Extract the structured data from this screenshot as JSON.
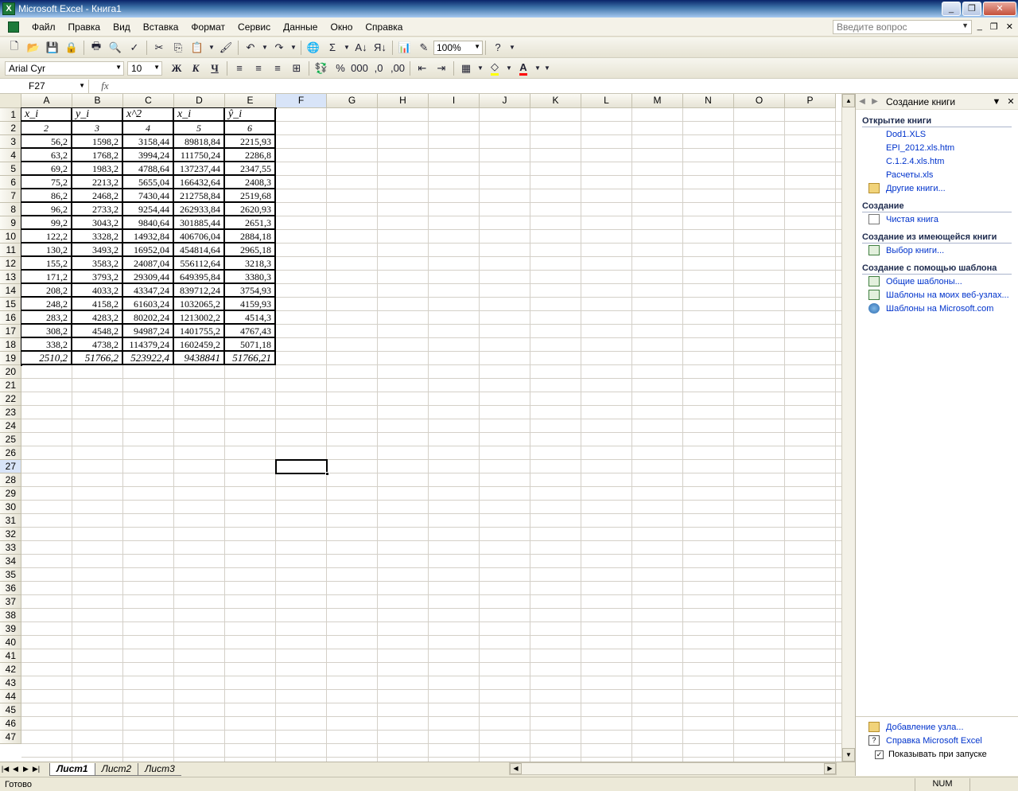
{
  "window": {
    "title": "Microsoft Excel - Книга1"
  },
  "menu": {
    "items": [
      "Файл",
      "Правка",
      "Вид",
      "Вставка",
      "Формат",
      "Сервис",
      "Данные",
      "Окно",
      "Справка"
    ],
    "help_placeholder": "Введите вопрос"
  },
  "toolbar": {
    "zoom": "100%",
    "font_name": "Arial Cyr",
    "font_size": "10",
    "bold_label": "Ж",
    "italic_label": "К",
    "underline_label": "Ч"
  },
  "formula_bar": {
    "name_box": "F27",
    "fx_label": "fx",
    "content": ""
  },
  "grid": {
    "columns": [
      "A",
      "B",
      "C",
      "D",
      "E",
      "F",
      "G",
      "H",
      "I",
      "J",
      "K",
      "L",
      "M",
      "N",
      "O",
      "P"
    ],
    "active_column": "F",
    "active_row": 27,
    "row_count": 47,
    "table_header": [
      "x_i",
      "y_i",
      "x^2",
      "x_i",
      "ŷ_i"
    ],
    "table_index": [
      "2",
      "3",
      "4",
      "5",
      "6"
    ],
    "table_rows": [
      [
        "56,2",
        "1598,2",
        "3158,44",
        "89818,84",
        "2215,93"
      ],
      [
        "63,2",
        "1768,2",
        "3994,24",
        "111750,24",
        "2286,8"
      ],
      [
        "69,2",
        "1983,2",
        "4788,64",
        "137237,44",
        "2347,55"
      ],
      [
        "75,2",
        "2213,2",
        "5655,04",
        "166432,64",
        "2408,3"
      ],
      [
        "86,2",
        "2468,2",
        "7430,44",
        "212758,84",
        "2519,68"
      ],
      [
        "96,2",
        "2733,2",
        "9254,44",
        "262933,84",
        "2620,93"
      ],
      [
        "99,2",
        "3043,2",
        "9840,64",
        "301885,44",
        "2651,3"
      ],
      [
        "122,2",
        "3328,2",
        "14932,84",
        "406706,04",
        "2884,18"
      ],
      [
        "130,2",
        "3493,2",
        "16952,04",
        "454814,64",
        "2965,18"
      ],
      [
        "155,2",
        "3583,2",
        "24087,04",
        "556112,64",
        "3218,3"
      ],
      [
        "171,2",
        "3793,2",
        "29309,44",
        "649395,84",
        "3380,3"
      ],
      [
        "208,2",
        "4033,2",
        "43347,24",
        "839712,24",
        "3754,93"
      ],
      [
        "248,2",
        "4158,2",
        "61603,24",
        "1032065,2",
        "4159,93"
      ],
      [
        "283,2",
        "4283,2",
        "80202,24",
        "1213002,2",
        "4514,3"
      ],
      [
        "308,2",
        "4548,2",
        "94987,24",
        "1401755,2",
        "4767,43"
      ],
      [
        "338,2",
        "4738,2",
        "114379,24",
        "1602459,2",
        "5071,18"
      ]
    ],
    "table_totals": [
      "2510,2",
      "51766,2",
      "523922,4",
      "9438841",
      "51766,21"
    ]
  },
  "sheets": {
    "tabs": [
      "Лист1",
      "Лист2",
      "Лист3"
    ],
    "active": "Лист1"
  },
  "status": {
    "text": "Готово",
    "num_indicator": "NUM"
  },
  "taskpane": {
    "title": "Создание книги",
    "sections": [
      {
        "title": "Открытие книги",
        "links": [
          {
            "label": "Dod1.XLS",
            "icon": "none"
          },
          {
            "label": "EPI_2012.xls.htm",
            "icon": "none"
          },
          {
            "label": "C.1.2.4.xls.htm",
            "icon": "none"
          },
          {
            "label": "Расчеты.xls",
            "icon": "none"
          },
          {
            "label": "Другие книги...",
            "icon": "folder-icon"
          }
        ]
      },
      {
        "title": "Создание",
        "links": [
          {
            "label": "Чистая книга",
            "icon": "page-icon"
          }
        ]
      },
      {
        "title": "Создание из имеющейся книги",
        "links": [
          {
            "label": "Выбор книги...",
            "icon": "xls-icon"
          }
        ]
      },
      {
        "title": "Создание с помощью шаблона",
        "links": [
          {
            "label": "Общие шаблоны...",
            "icon": "xls-icon"
          },
          {
            "label": "Шаблоны на моих веб-узлах...",
            "icon": "xls-icon"
          },
          {
            "label": "Шаблоны на Microsoft.com",
            "icon": "globe-icon"
          }
        ]
      }
    ],
    "bottom_links": [
      {
        "label": "Добавление узла...",
        "icon": "folder-icon"
      },
      {
        "label": "Справка Microsoft Excel",
        "icon": "help-icon"
      }
    ],
    "startup_checkbox": {
      "label": "Показывать при запуске",
      "checked": true
    }
  }
}
